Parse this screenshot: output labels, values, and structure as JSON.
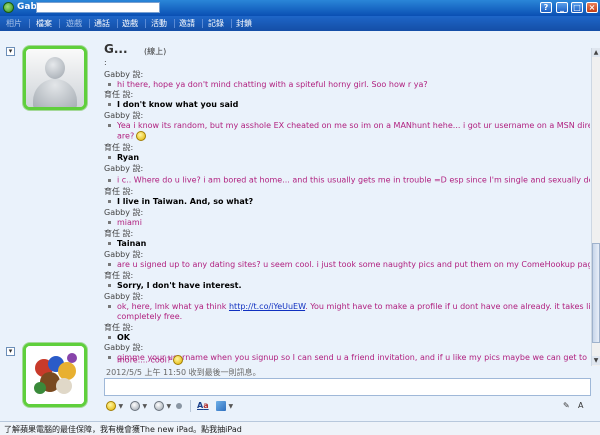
{
  "window": {
    "title": "Gabby",
    "buttons": {
      "help": "?",
      "minimize": "_",
      "maximize": "□",
      "close": "×"
    }
  },
  "menu": {
    "items": [
      {
        "label": "相片",
        "enabled": false
      },
      {
        "label": "檔案",
        "enabled": true
      },
      {
        "label": "遊戲",
        "enabled": false
      },
      {
        "label": "通話",
        "enabled": true
      },
      {
        "label": "遊戲",
        "enabled": true
      },
      {
        "label": "活動",
        "enabled": true
      },
      {
        "label": "邀請",
        "enabled": true
      },
      {
        "label": "記錄",
        "enabled": true
      },
      {
        "label": "封鎖",
        "enabled": true
      }
    ]
  },
  "contact": {
    "name": "G...",
    "status": "(線上)"
  },
  "chat": {
    "top_fragment": ":",
    "messages": [
      {
        "speaker": "Gabby 說:",
        "from": "gabby",
        "text": "hi there, hope ya don't mind chatting with a spiteful horny girl. Soo how r ya?"
      },
      {
        "speaker": "育任 說:",
        "from": "self",
        "text": "I don't know what you said"
      },
      {
        "speaker": "Gabby 說:",
        "from": "gabby",
        "text": "Yea i know its random, but my asshole EX cheated on me so im on a MANhunt hehe... i got ur username on a MSN directory, I'm gabby, u",
        "text2": "are?"
      },
      {
        "speaker": "育任 說:",
        "from": "self",
        "text": "Ryan"
      },
      {
        "speaker": "Gabby 說:",
        "from": "gabby",
        "text": "i c.. Where do u live? i am bored at home... and this usually gets me in trouble =D esp since I'm single and sexually deprived"
      },
      {
        "speaker": "育任 說:",
        "from": "self",
        "text": "I live in Taiwan. And, so what?"
      },
      {
        "speaker": "Gabby 說:",
        "from": "gabby",
        "text": "miami"
      },
      {
        "speaker": "育任 說:",
        "from": "self",
        "text": "Tainan"
      },
      {
        "speaker": "Gabby 說:",
        "from": "gabby",
        "text": "are u signed up to any dating sites? u seem cool. i just took some naughty pics and put them on my ComeHookup page.. want to see? hehe"
      },
      {
        "speaker": "育任 說:",
        "from": "self",
        "text": "Sorry, I don't have interest."
      },
      {
        "speaker": "Gabby 說:",
        "from": "gabby",
        "text": "ok, here, lmk what ya think",
        "link": "http://t.co/iYeUuEW",
        "text_after": ". You might have to make a profile if u dont have one already. it takes literally 1 min and its",
        "text2": "completely free."
      },
      {
        "speaker": "育任 說:",
        "from": "self",
        "text": "OK"
      },
      {
        "speaker": "Gabby 說:",
        "from": "gabby",
        "text": "gimme your username when you signup so I can send u a friend invitation, and if u like my pics maybe we can get to know each other a little",
        "text2": "more.... cool?"
      }
    ],
    "last_received": "2012/5/5 上午 11:50 收到最後一則訊息。"
  },
  "input": {
    "value": ""
  },
  "toolbar": {
    "emoticons": "emoticon-smiley-icon",
    "winks": "wink-icon",
    "nudge": "nudge-icon",
    "font_label": "A",
    "background": "background-icon"
  },
  "ad": {
    "text": "了解蘋果電腦的最佳保障，我有機會獲The new iPad。點我抽iPad"
  },
  "colors": {
    "gabby_text": "#b0207f",
    "title_bar": "#0a4fb3",
    "avatar_border": "#5fcf3c"
  }
}
